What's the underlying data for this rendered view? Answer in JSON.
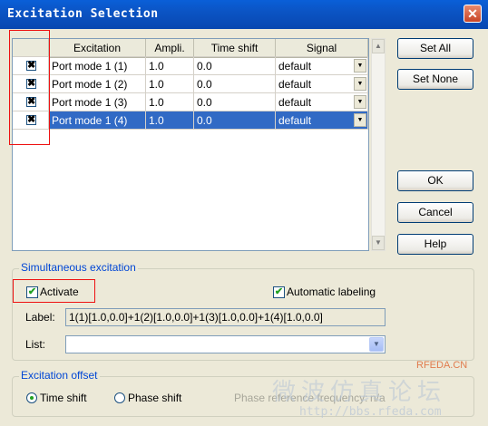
{
  "window": {
    "title": "Excitation Selection",
    "close_glyph": "✕"
  },
  "table": {
    "columns": [
      "",
      "Excitation",
      "Ampli.",
      "Time shift",
      "Signal"
    ],
    "rows": [
      {
        "checked": "✖",
        "excitation": "Port mode 1 (1)",
        "ampli": "1.0",
        "time_shift": "0.0",
        "signal": "default",
        "selected": false
      },
      {
        "checked": "✖",
        "excitation": "Port mode 1 (2)",
        "ampli": "1.0",
        "time_shift": "0.0",
        "signal": "default",
        "selected": false
      },
      {
        "checked": "✖",
        "excitation": "Port mode 1 (3)",
        "ampli": "1.0",
        "time_shift": "0.0",
        "signal": "default",
        "selected": false
      },
      {
        "checked": "✖",
        "excitation": "Port mode 1 (4)",
        "ampli": "1.0",
        "time_shift": "0.0",
        "signal": "default",
        "selected": true
      }
    ]
  },
  "buttons": {
    "set_all": "Set All",
    "set_none": "Set None",
    "ok": "OK",
    "cancel": "Cancel",
    "help": "Help"
  },
  "simultaneous": {
    "legend": "Simultaneous excitation",
    "activate_label": "Activate",
    "activate_checked": "✔",
    "auto_label": "Automatic labeling",
    "auto_checked": "✔",
    "label_caption": "Label:",
    "label_value": "1(1)[1.0,0.0]+1(2)[1.0,0.0]+1(3)[1.0,0.0]+1(4)[1.0,0.0]",
    "list_caption": "List:",
    "list_value": ""
  },
  "offset": {
    "legend": "Excitation offset",
    "time_shift_label": "Time shift",
    "phase_shift_label": "Phase shift",
    "selected": "time_shift",
    "phase_ref_label": "Phase reference frequency:",
    "phase_ref_value": "n/a"
  },
  "watermark": {
    "brand": "RFEDA.CN",
    "chinese": "微波仿真论坛",
    "url": "http://bbs.rfeda.com"
  }
}
